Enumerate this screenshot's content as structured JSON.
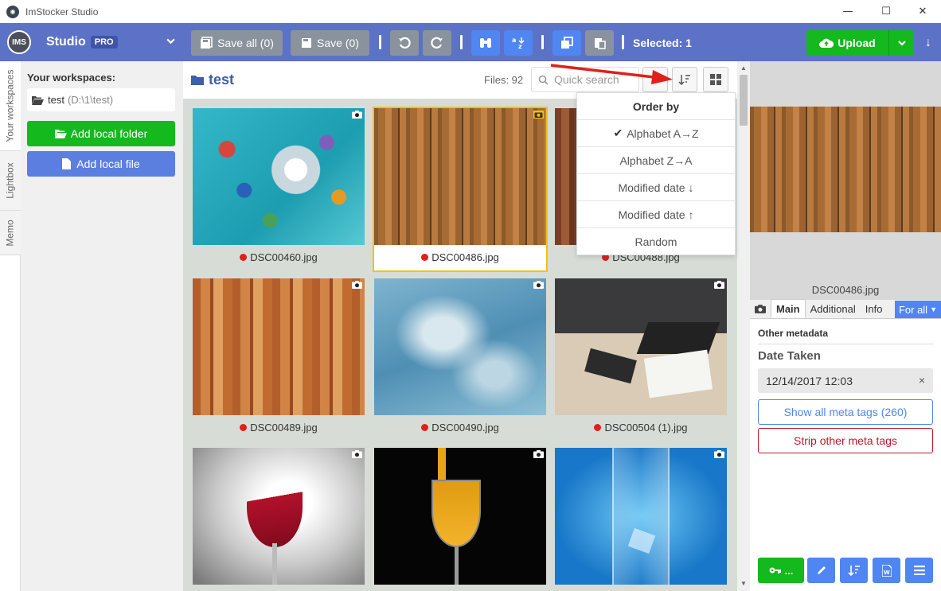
{
  "window": {
    "title": "ImStocker Studio",
    "minimize": "—",
    "maximize": "☐",
    "close": "✕"
  },
  "brand": {
    "logo": "IMS",
    "name": "Studio",
    "badge": "PRO"
  },
  "toolbar": {
    "save_all": "Save all (0)",
    "save": "Save (0)",
    "selected": "Selected: 1",
    "upload": "Upload"
  },
  "vtabs": [
    "Your workspaces",
    "Lightbox",
    "Memo"
  ],
  "sidebar": {
    "title": "Your workspaces:",
    "workspace_name": "test",
    "workspace_path": "(D:\\1\\test)",
    "add_folder": "Add local folder",
    "add_file": "Add local file"
  },
  "gallery": {
    "folder": "test",
    "files": "Files: 92",
    "search_placeholder": "Quick search",
    "items": [
      {
        "name": "DSC00460.jpg",
        "selected": false
      },
      {
        "name": "DSC00486.jpg",
        "selected": true
      },
      {
        "name": "DSC00488.jpg",
        "selected": false
      },
      {
        "name": "DSC00489.jpg",
        "selected": false
      },
      {
        "name": "DSC00490.jpg",
        "selected": false
      },
      {
        "name": "DSC00504 (1).jpg",
        "selected": false
      },
      {
        "name": "",
        "selected": false
      },
      {
        "name": "",
        "selected": false
      },
      {
        "name": "",
        "selected": false
      }
    ]
  },
  "order_menu": {
    "title": "Order by",
    "options": [
      "Alphabet A→Z",
      "Alphabet Z→A",
      "Modified date ↓",
      "Modified date ↑",
      "Random"
    ],
    "checked": "✔"
  },
  "details": {
    "preview_name": "DSC00486.jpg",
    "tabs": [
      "Main",
      "Additional",
      "Info"
    ],
    "for_all": "For all",
    "section": "Other metadata",
    "date_label": "Date Taken",
    "date_value": "12/14/2017 12:03",
    "clear": "×",
    "show_all": "Show all meta tags (260)",
    "strip": "Strip other meta tags",
    "key_btn": "..."
  },
  "colors": {
    "accent": "#5b72c7",
    "green": "#14b91d",
    "blue": "#4f86f2",
    "red_dot": "#e0201a",
    "selection": "#f3c20e"
  }
}
